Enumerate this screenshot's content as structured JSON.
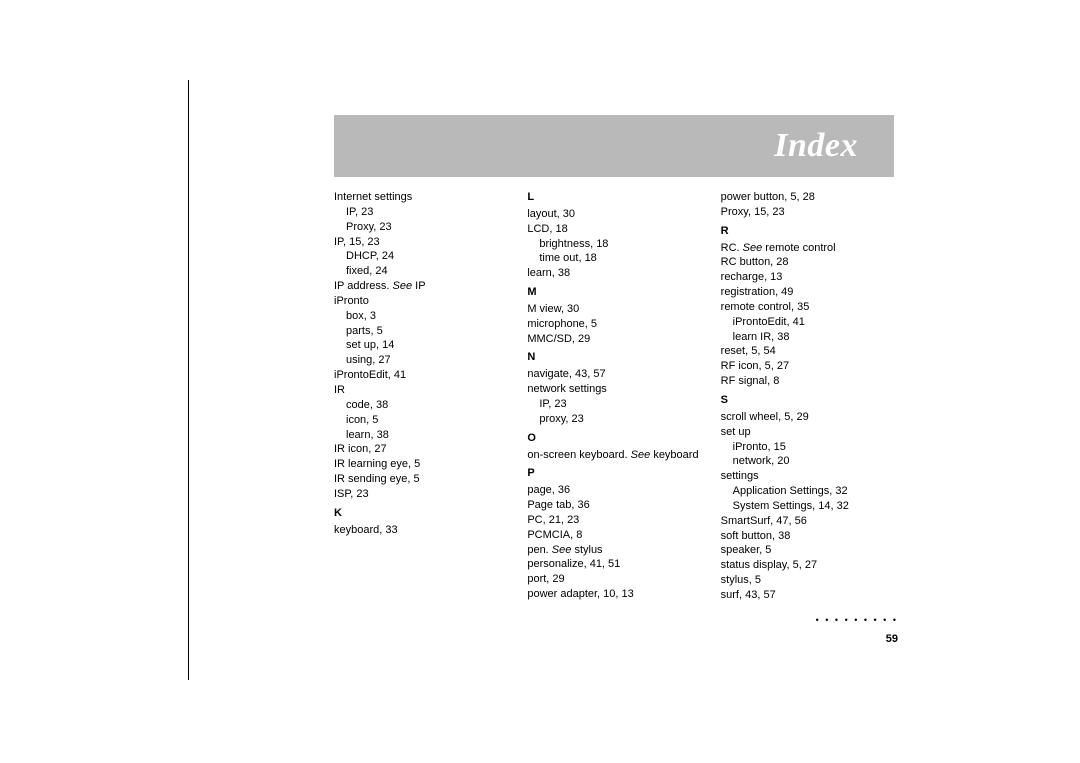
{
  "banner_title": "Index",
  "page_number": "59",
  "dots": "• • • • • • • • •",
  "col1": {
    "head_I": "",
    "i1": "Internet settings",
    "i1a": "IP, 23",
    "i1b": "Proxy, 23",
    "i2": "IP, 15, 23",
    "i2a": "DHCP, 24",
    "i2b": "fixed, 24",
    "i3_pre": "IP address. ",
    "i3_see": "See ",
    "i3_post": "IP",
    "i4": "iPronto",
    "i4a": "box, 3",
    "i4b": "parts, 5",
    "i4c": "set up, 14",
    "i4d": "using, 27",
    "i5": "iProntoEdit, 41",
    "i6": "IR",
    "i6a": "code, 38",
    "i6b": "icon, 5",
    "i6c": "learn, 38",
    "i7": "IR icon, 27",
    "i8": "IR learning eye, 5",
    "i9": "IR sending eye, 5",
    "i10": "ISP, 23",
    "head_K": "K",
    "k1": "keyboard, 33"
  },
  "col2": {
    "head_L": "L",
    "l1": "layout, 30",
    "l2": "LCD, 18",
    "l2a": "brightness, 18",
    "l2b": "time out, 18",
    "l3": "learn, 38",
    "head_M": "M",
    "m1": "M view, 30",
    "m2": "microphone, 5",
    "m3": "MMC/SD, 29",
    "head_N": "N",
    "n1": "navigate, 43, 57",
    "n2": "network settings",
    "n2a": "IP, 23",
    "n2b": "proxy, 23",
    "head_O": "O",
    "o1_pre": "on-screen keyboard. ",
    "o1_see": "See ",
    "o1_post": "keyboard",
    "head_P": "P",
    "p1": "page, 36",
    "p2": "Page tab, 36",
    "p3": "PC, 21, 23",
    "p4": "PCMCIA, 8",
    "p5_pre": "pen. ",
    "p5_see": "See ",
    "p5_post": "stylus",
    "p6": "personalize, 41, 51",
    "p7": "port, 29",
    "p8": "power adapter, 10, 13"
  },
  "col3": {
    "c1": "power button, 5, 28",
    "c2": "Proxy, 15, 23",
    "head_R": "R",
    "r1_pre": "RC. ",
    "r1_see": "See ",
    "r1_post": "remote control",
    "r2": "RC button, 28",
    "r3": "recharge, 13",
    "r4": "registration, 49",
    "r5": "remote control, 35",
    "r5a": "iProntoEdit, 41",
    "r5b": "learn IR, 38",
    "r6": "reset, 5, 54",
    "r7": "RF icon, 5, 27",
    "r8": "RF signal, 8",
    "head_S": "S",
    "s1": "scroll wheel, 5, 29",
    "s2": "set up",
    "s2a": "iPronto, 15",
    "s2b": "network, 20",
    "s3": "settings",
    "s3a": "Application Settings, 32",
    "s3b": "System Settings, 14, 32",
    "s4": "SmartSurf, 47, 56",
    "s5": "soft button, 38",
    "s6": "speaker, 5",
    "s7": "status display, 5, 27",
    "s8": "stylus, 5",
    "s9": "surf, 43, 57"
  }
}
